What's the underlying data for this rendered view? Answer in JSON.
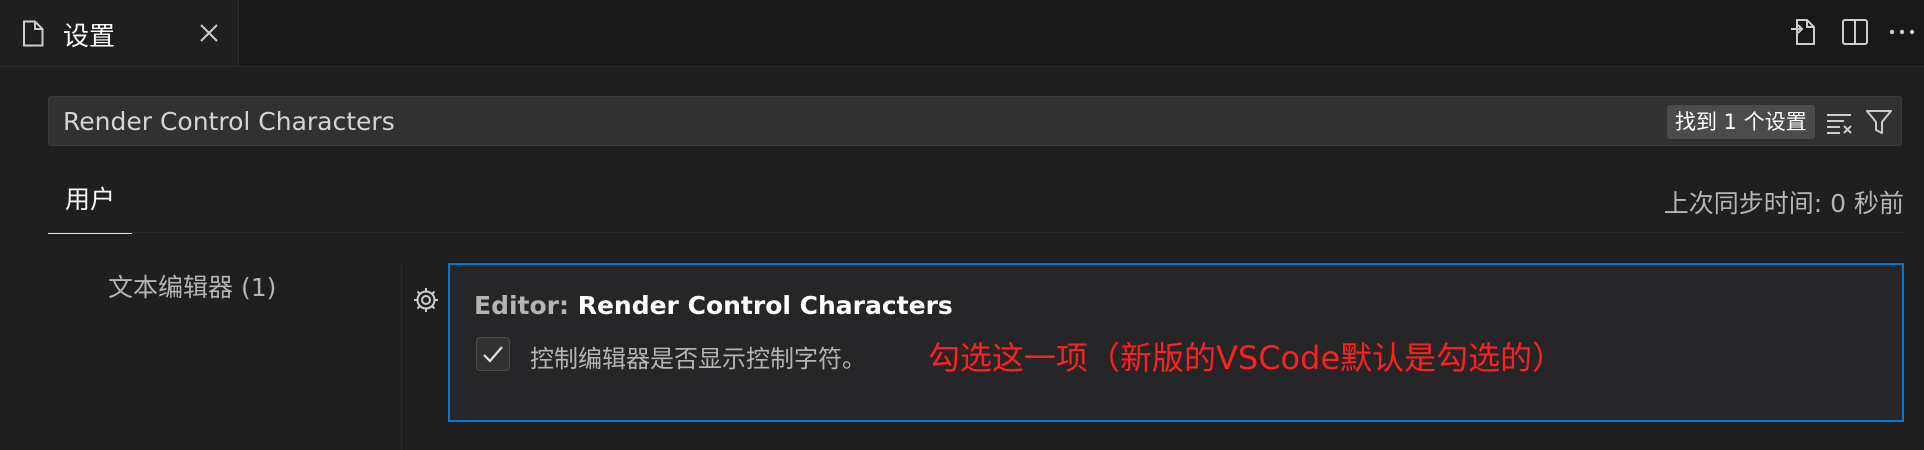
{
  "editor_tab": {
    "title": "设置",
    "icons": {
      "file": "file-icon",
      "close": "close-icon"
    }
  },
  "editor_actions": {
    "icons": [
      "open-settings-json-icon",
      "split-editor-icon",
      "more-actions-icon"
    ]
  },
  "search": {
    "value": "Render Control Characters",
    "result_count": "找到 1 个设置",
    "icons": {
      "clear": "clear-filter-icon",
      "filter": "filter-icon"
    }
  },
  "scope": {
    "active_tab": "用户",
    "sync_status": "上次同步时间: 0 秒前"
  },
  "toc": {
    "items": [
      {
        "label": "文本编辑器 (1)"
      }
    ]
  },
  "setting": {
    "category": "Editor: ",
    "name": "Render Control Characters",
    "description": "控制编辑器是否显示控制字符。",
    "checked": true,
    "gear_icon": "gear-icon"
  },
  "annotation": {
    "text": "勾选这一项（新版的VSCode默认是勾选的）",
    "color": "#ff1f1f"
  },
  "colors": {
    "focus_border": "#0078d4",
    "background": "#1f1f1f",
    "badge": "#4b4b4b"
  }
}
